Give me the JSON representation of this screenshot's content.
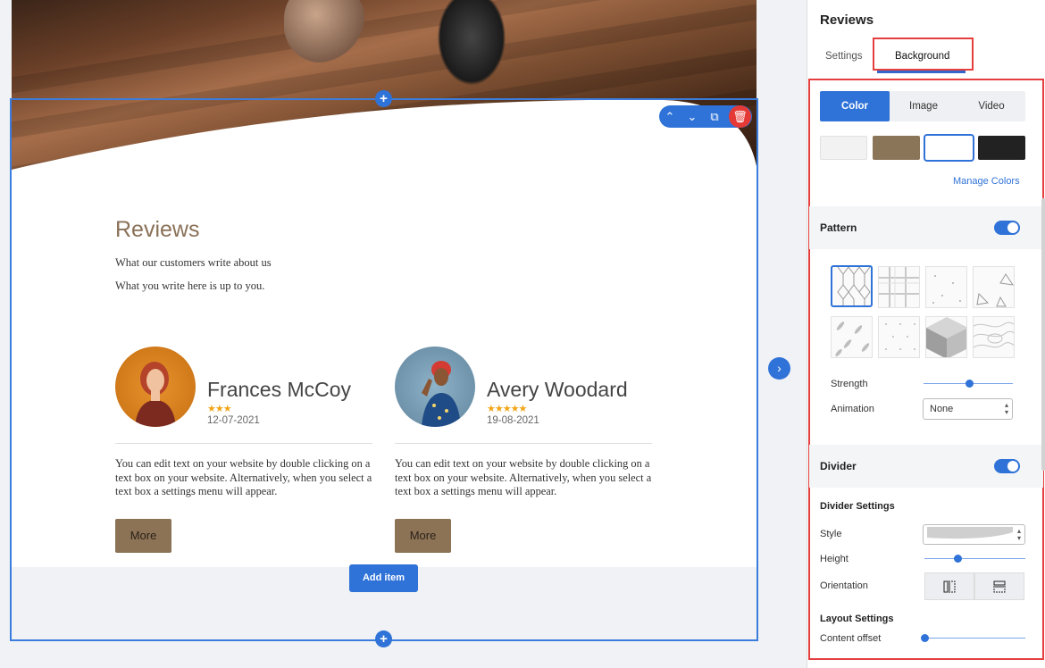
{
  "canvas": {
    "section_title": "Reviews",
    "subtitle_1": "What our customers write about us",
    "subtitle_2": "What you write here is up to you.",
    "reviews": [
      {
        "name": "Frances McCoy",
        "stars": "★★★",
        "rating": 3,
        "date": "12-07-2021",
        "text": "You can edit text on your website by double clicking on a text box on your website. Alternatively, when you select a text box a settings menu will appear.",
        "more_label": "More"
      },
      {
        "name": "Avery Woodard",
        "stars": "★★★★★",
        "rating": 5,
        "date": "19-08-2021",
        "text": "You can edit text on your website by double clicking on a text box on your website. Alternatively, when you select a text box a settings menu will appear.",
        "more_label": "More"
      }
    ],
    "add_item_label": "Add item",
    "plus_symbol": "+",
    "next_symbol": "›",
    "toolbar": {
      "up": "⌃",
      "down": "⌄",
      "copy": "⧉",
      "delete": "🗑"
    }
  },
  "panel": {
    "title": "Reviews",
    "tabs": [
      "Settings",
      "Background"
    ],
    "active_tab": "Background",
    "bg_types": [
      "Color",
      "Image",
      "Video"
    ],
    "active_bg_type": "Color",
    "swatch_colors": [
      "#f2f2f2",
      "#8b7558",
      "#ffffff",
      "#222222"
    ],
    "selected_swatch": 2,
    "manage_colors": "Manage Colors",
    "pattern_label": "Pattern",
    "pattern_enabled": true,
    "strength_label": "Strength",
    "strength_value": 0.5,
    "animation_label": "Animation",
    "animation_value": "None",
    "divider_label": "Divider",
    "divider_enabled": true,
    "divider_settings_label": "Divider Settings",
    "style_label": "Style",
    "height_label": "Height",
    "height_value": 0.3,
    "orientation_label": "Orientation",
    "layout_settings_label": "Layout Settings",
    "content_offset_label": "Content offset",
    "content_offset_value": 0.0
  },
  "colors": {
    "accent": "#2f72d8",
    "highlight_border": "#e53e3e",
    "brand_brown": "#8c7356",
    "star": "#f2a516"
  }
}
